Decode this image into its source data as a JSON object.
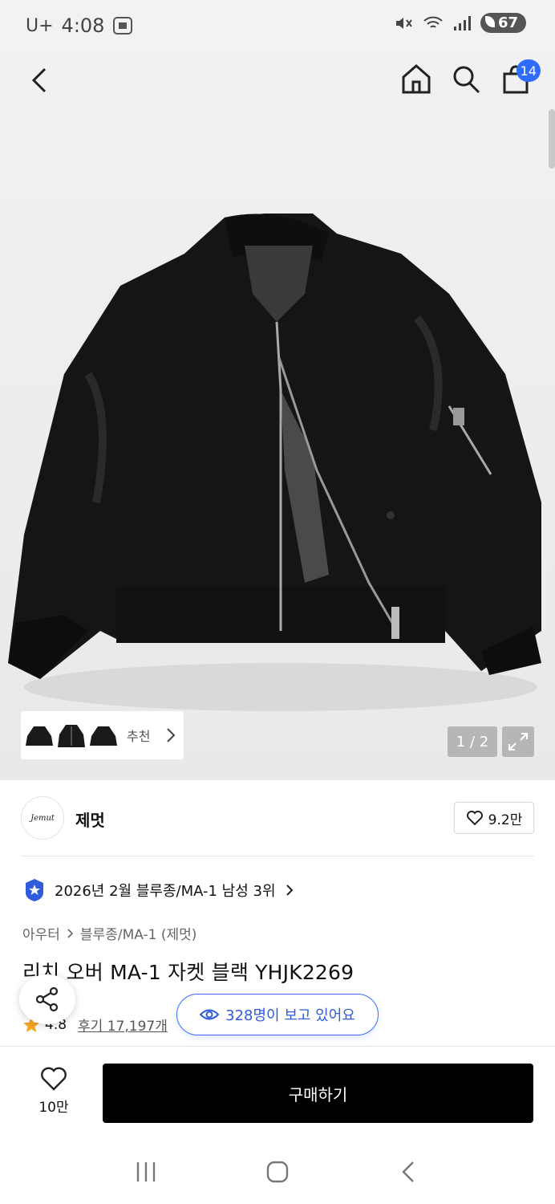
{
  "status": {
    "carrier": "U+",
    "time": "4:08",
    "battery": "67"
  },
  "header": {
    "cart_count": "14"
  },
  "gallery": {
    "recommend_label": "추천",
    "pager": "1 / 2"
  },
  "brand": {
    "logo_text": "Jemut",
    "name": "제멋",
    "likes": "9.2만"
  },
  "ranking": {
    "text": "2026년 2월 블루종/MA-1 남성 3위"
  },
  "breadcrumb": {
    "level1": "아우터",
    "level2": "블루종/MA-1 (제멋)"
  },
  "product": {
    "title": "리치 오버 MA-1 자켓 블랙 YHJK2269",
    "rating": "4.8",
    "reviews": "후기 17,197개",
    "viewers": "328명이 보고 있어요"
  },
  "footer": {
    "wish_count": "10만",
    "buy_label": "구매하기"
  },
  "colors": {
    "accent": "#2f6bff",
    "buy_button": "#000000",
    "star": "#f5a623"
  }
}
